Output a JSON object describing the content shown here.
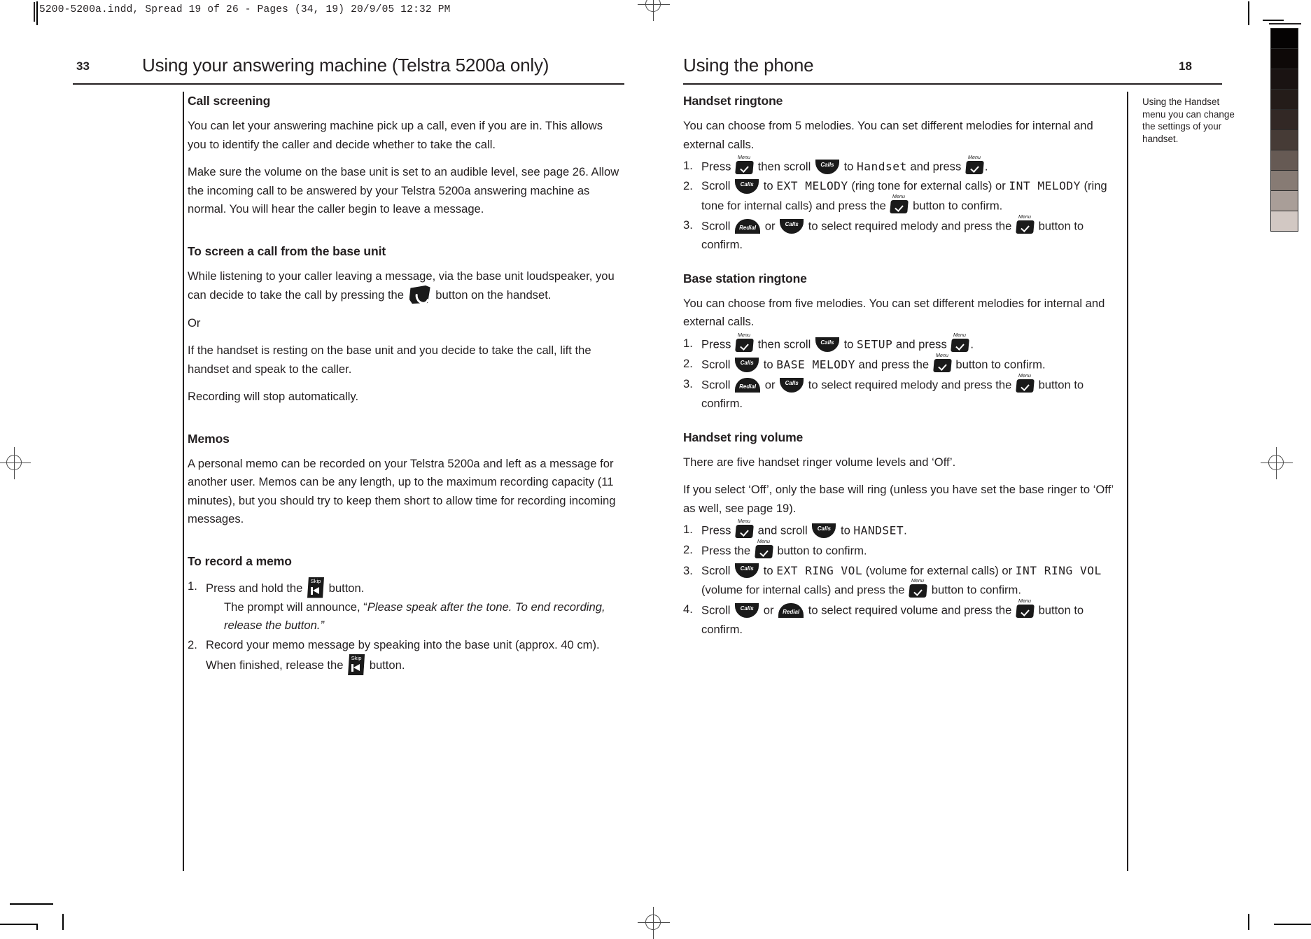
{
  "slug": {
    "text": "5200-5200a.indd, Spread 19 of 26 - Pages (34, 19) 20/9/05 12:32 PM"
  },
  "calibration": {
    "name": "grayscale-step-wedge",
    "swatches": [
      "#050303",
      "#0e0908",
      "#1a1312",
      "#241c19",
      "#322825",
      "#463b36",
      "#665a54",
      "#877b74",
      "#a99e98",
      "#d2c8c3"
    ]
  },
  "left_page": {
    "folio": "33",
    "header": "Using your answering machine (Telstra 5200a only)",
    "sections": [
      {
        "heading": "Call screening",
        "paragraphs": [
          "You can let your answering machine pick up a call, even if you are in. This allows you to identify the caller and decide whether to take the call.",
          "Make sure the volume on the base unit is set to an audible level, see page 26. Allow the incoming call to be answered by your Telstra 5200a answering machine as normal. You will hear the caller begin to leave a message."
        ]
      },
      {
        "heading": "To screen a call from the base unit",
        "p1_a": "While listening to your caller leaving a message, via the base unit loudspeaker, you can decide to take the call by pressing the",
        "p1_b": "button on the handset.",
        "or": "Or",
        "p2": "If the handset is resting on the base unit and you decide to take the call, lift the handset and speak to the caller.",
        "p3": "Recording will stop automatically."
      },
      {
        "heading": "Memos",
        "paragraphs": [
          "A personal memo can be recorded on your Telstra 5200a and left as a message for another user. Memos can be any length, up to the maximum recording capacity (11 minutes), but you should try to keep them short to allow time for recording incoming messages."
        ]
      },
      {
        "heading": "To record a memo",
        "steps": [
          {
            "num": "1.",
            "a": "Press and hold the",
            "b": "button.",
            "sub_lead": "The prompt will announce, “",
            "sub_italic": "Please speak after the tone. To end recording, release the button.”"
          },
          {
            "num": "2.",
            "a": "Record your memo message by speaking into the base unit (approx. 40 cm). When finished, release the",
            "b": "button."
          }
        ]
      }
    ]
  },
  "right_page": {
    "folio": "18",
    "header": "Using the phone",
    "margin_note": "Using the Handset menu you can change the settings of your handset.",
    "sections": [
      {
        "heading": "Handset ringtone",
        "intro": "You can choose from 5 melodies. You can set different melodies for internal and external calls.",
        "steps": [
          {
            "num": "1.",
            "a": "Press",
            "b": "then scroll",
            "c": "to",
            "lcd1": "Handset",
            "d": "and press",
            "e": "."
          },
          {
            "num": "2.",
            "a": "Scroll",
            "b": "to",
            "lcd1": "EXT  MELODY",
            "c": "(ring tone for external calls) or",
            "lcd2": "INT MELODY",
            "d": "(ring tone for internal calls) and press the",
            "e": "button to confirm."
          },
          {
            "num": "3.",
            "a": "Scroll",
            "b": "or",
            "c": "to select required melody and press the",
            "d": "button to confirm."
          }
        ]
      },
      {
        "heading": "Base station ringtone",
        "intro": "You can choose from five melodies. You can set different melodies for internal and external calls.",
        "steps": [
          {
            "num": "1.",
            "a": "Press",
            "b": "then scroll",
            "c": "to",
            "lcd1": "SETUP",
            "d": "and press",
            "e": "."
          },
          {
            "num": "2.",
            "a": "Scroll",
            "b": "to",
            "lcd1": "BASE  MELODY",
            "c": "and press the",
            "d": "button to confirm."
          },
          {
            "num": "3.",
            "a": "Scroll",
            "b": "or",
            "c": "to select required melody and press the",
            "d": "button to confirm."
          }
        ]
      },
      {
        "heading": "Handset ring volume",
        "intro1": "There are five handset ringer volume levels and ‘Off’.",
        "intro2": "If you select ‘Off’, only the base will ring (unless you have set the base ringer to ‘Off’ as well, see page 19).",
        "steps": [
          {
            "num": "1.",
            "a": "Press",
            "b": "and scroll",
            "c": "to",
            "lcd1": "HANDSET",
            "d": "."
          },
          {
            "num": "2.",
            "a": "Press the",
            "b": "button to confirm."
          },
          {
            "num": "3.",
            "a": "Scroll",
            "b": "to",
            "lcd1": "EXT  RING  VOL",
            "c": "(volume for external calls) or",
            "lcd2": "INT RING  VOL",
            "d": "(volume for internal calls) and press the",
            "e": "button to confirm."
          },
          {
            "num": "4.",
            "a": "Scroll",
            "b": "or",
            "c": "to select required volume and press the",
            "d": "button to confirm."
          }
        ]
      }
    ]
  },
  "keys": {
    "menu": "Menu",
    "calls": "Calls",
    "redial": "Redial",
    "skip": "Skip"
  }
}
